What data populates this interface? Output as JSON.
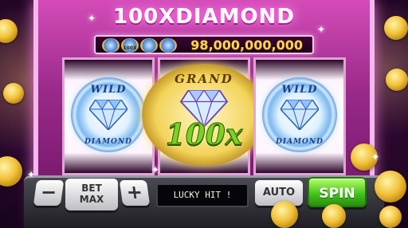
{
  "header": {
    "title": "100XDIAMOND"
  },
  "jackpot": {
    "mini_label": "100X",
    "value": "98,000,000,000"
  },
  "reels": [
    {
      "symbol": "wild-diamond",
      "top_text": "WILD",
      "bottom_text": "DIAMOND"
    },
    {
      "symbol": "grand-100x",
      "top_text": "GRAND",
      "bottom_text": "100x"
    },
    {
      "symbol": "wild-diamond",
      "top_text": "WILD",
      "bottom_text": "DIAMOND"
    }
  ],
  "controls": {
    "minus_label": "−",
    "bet_max_line1": "BET",
    "bet_max_line2": "MAX",
    "plus_label": "+",
    "message": "LUCKY HIT !",
    "auto_label": "AUTO",
    "spin_label": "SPIN"
  },
  "colors": {
    "cabinet": "#9a2a8a",
    "jackpot_text": "#ffd54a",
    "spin_button": "#3fbf1a",
    "multiplier_text": "#7cd126"
  },
  "icons": [
    "diamond-icon",
    "coin-icon",
    "sparkle-icon"
  ]
}
